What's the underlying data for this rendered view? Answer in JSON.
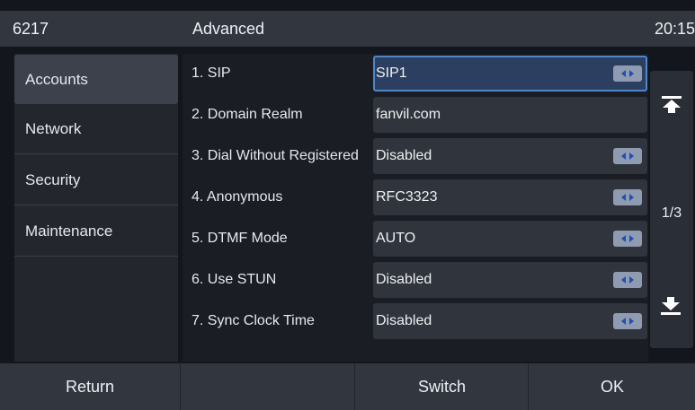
{
  "header": {
    "model": "6217",
    "title": "Advanced",
    "time": "20:15"
  },
  "sidebar": {
    "items": [
      {
        "label": "Accounts",
        "active": true
      },
      {
        "label": "Network",
        "active": false
      },
      {
        "label": "Security",
        "active": false
      },
      {
        "label": "Maintenance",
        "active": false
      }
    ]
  },
  "settings": {
    "rows": [
      {
        "label": "1. SIP",
        "value": "SIP1",
        "has_selector": true
      },
      {
        "label": "2. Domain Realm",
        "value": "fanvil.com",
        "has_selector": false
      },
      {
        "label": "3. Dial Without Registered",
        "value": "Disabled",
        "has_selector": true
      },
      {
        "label": "4. Anonymous",
        "value": "RFC3323",
        "has_selector": true
      },
      {
        "label": "5. DTMF Mode",
        "value": "AUTO",
        "has_selector": true
      },
      {
        "label": "6. Use STUN",
        "value": "Disabled",
        "has_selector": true
      },
      {
        "label": "7. Sync Clock Time",
        "value": "Disabled",
        "has_selector": true
      }
    ]
  },
  "pager": {
    "page_indicator": "1/3",
    "up_icon": "page-top-icon",
    "down_icon": "page-bottom-icon"
  },
  "footer": {
    "buttons": [
      "Return",
      "",
      "Switch",
      "OK"
    ]
  },
  "colors": {
    "header_bg": "#32363f",
    "active_field_border": "#4f86c8",
    "selector_button": "#8e9bb0",
    "selector_arrow": "#1f4fb5"
  }
}
